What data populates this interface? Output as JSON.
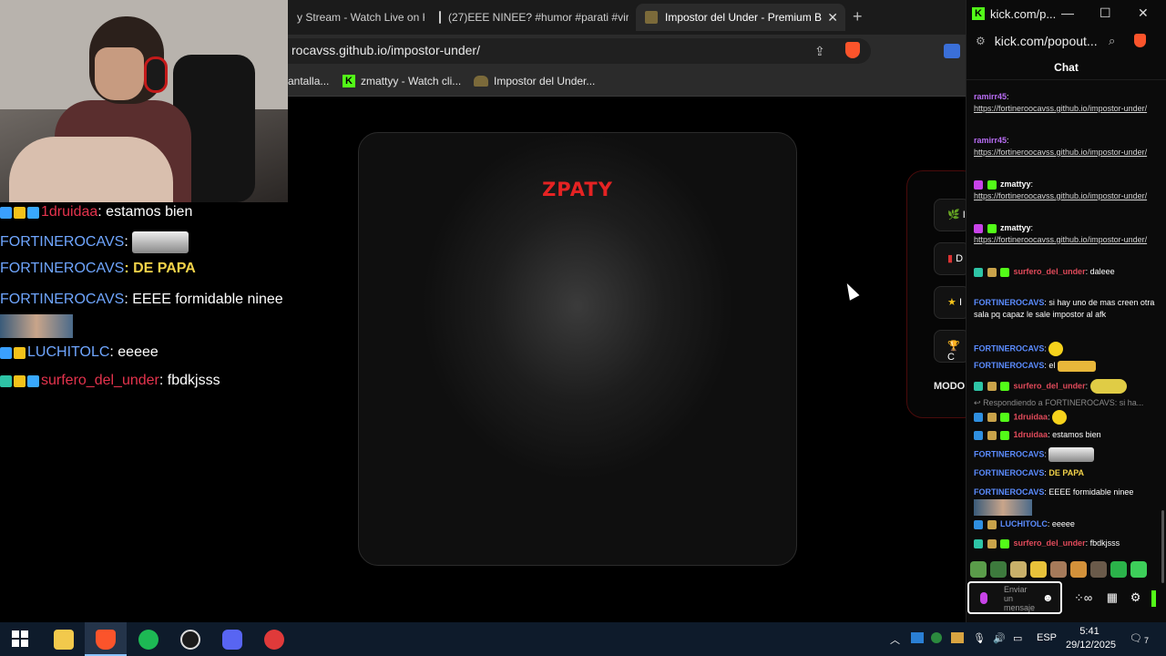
{
  "browser": {
    "tabs": [
      {
        "label": "y Stream - Watch Live on K"
      },
      {
        "label": "(27)EEE NINEE? #humor #parati #vira"
      },
      {
        "label": "Impostor del Under - Premium B"
      }
    ],
    "new_tab": "+",
    "close": "✕",
    "url": "rocavss.github.io/impostor-under/",
    "bookmarks": [
      {
        "label": "antalla..."
      },
      {
        "label": "zmattyy - Watch cli..."
      },
      {
        "label": "Impostor del Under..."
      }
    ]
  },
  "page": {
    "logo": "ZPATY",
    "side_panel_buttons": [
      {
        "icon": "leaf-icon",
        "glyph": "🌿",
        "label": "I"
      },
      {
        "icon": "card-icon",
        "glyph": "▮",
        "label": "D"
      },
      {
        "icon": "star-icon",
        "glyph": "★",
        "label": "I"
      },
      {
        "icon": "trophy-icon",
        "glyph": "🏆",
        "label": "C"
      }
    ],
    "modo_label": "MODO"
  },
  "overlay": {
    "lines": [
      {
        "user": "1druidaa",
        "color": "#e4334d",
        "text": ": estamos bien"
      },
      {
        "user": "FORTINEROCAVS",
        "color": "#6fa6ff",
        "text": ":"
      },
      {
        "user": "FORTINEROCAVS",
        "color": "#6fa6ff",
        "text": ": DE PAPA"
      },
      {
        "user": "FORTINEROCAVS",
        "color": "#6fa6ff",
        "text": ": EEEE formidable ninee"
      },
      {
        "user": "LUCHITOLC",
        "color": "#6fa6ff",
        "text": ": eeeee"
      },
      {
        "user": "surfero_del_under",
        "color": "#e4334d",
        "text": ": fbdkjsss"
      }
    ]
  },
  "kick": {
    "window_title": "kick.com/p...",
    "url": "kick.com/popout...",
    "chat_title": "Chat",
    "messages": [
      {
        "user": "ramirr45",
        "color": "#b86df4",
        "text": "https://fortineroocavss.github.io/impostor-under/",
        "link": true
      },
      {
        "user": "ramirr45",
        "color": "#b86df4",
        "text": "https://fortineroocavss.github.io/impostor-under/",
        "link": true
      },
      {
        "user": "zmattyy",
        "color": "#ffffff",
        "text": "https://fortineroocavss.github.io/impostor-under/",
        "link": true
      },
      {
        "user": "zmattyy",
        "color": "#ffffff",
        "text": "https://fortineroocavss.github.io/impostor-under/",
        "link": true
      },
      {
        "user": "surfero_del_under",
        "color": "#e04a5a",
        "text": "daleee",
        "link": false
      },
      {
        "user": "FORTINEROCAVS",
        "color": "#5b8cff",
        "text": "si hay uno de mas creen otra sala pq capaz le sale impostor al afk",
        "link": false
      },
      {
        "user": "FORTINEROCAVS",
        "color": "#5b8cff",
        "text": "",
        "link": false
      },
      {
        "user": "FORTINEROCAVS",
        "color": "#5b8cff",
        "text": "el",
        "link": false
      },
      {
        "user": "surfero_del_under",
        "color": "#e04a5a",
        "text": "",
        "link": false
      },
      {
        "user": "1druidaa",
        "color": "#e04a5a",
        "text": "",
        "link": false
      },
      {
        "user": "1druidaa",
        "color": "#e04a5a",
        "text": "estamos bien",
        "link": false
      },
      {
        "user": "FORTINEROCAVS",
        "color": "#5b8cff",
        "text": "",
        "link": false
      },
      {
        "user": "FORTINEROCAVS",
        "color": "#5b8cff",
        "text": "DE PAPA",
        "link": false
      },
      {
        "user": "FORTINEROCAVS",
        "color": "#5b8cff",
        "text": "EEEE formidable ninee",
        "link": false
      },
      {
        "user": "LUCHITOLC",
        "color": "#5b8cff",
        "text": "eeeee",
        "link": false
      },
      {
        "user": "surfero_del_under",
        "color": "#e04a5a",
        "text": "fbdkjsss",
        "link": false
      }
    ],
    "reply_text": "Respondiendo a FORTINEROCAVS: si ha...",
    "input_placeholder": "Enviar un mensaje",
    "emote_button": "☻"
  },
  "taskbar": {
    "tray_lang": "ESP",
    "time": "5:41",
    "date": "29/12/2025",
    "notifications": "7"
  },
  "colors": {
    "accent_red": "#e52323",
    "kick_green": "#53fc18"
  }
}
